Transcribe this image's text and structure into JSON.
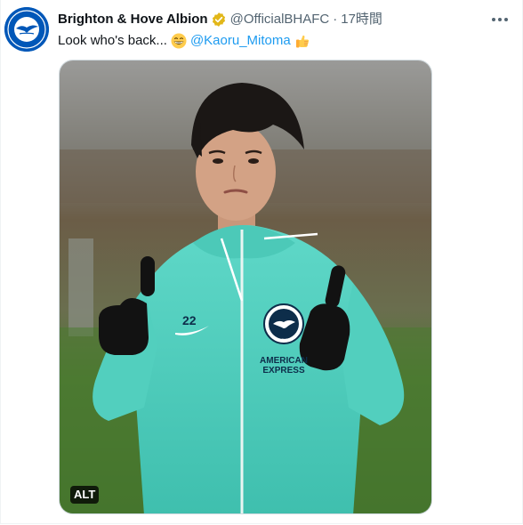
{
  "tweet": {
    "author_name": "Brighton & Hove Albion",
    "handle": "@OfficialBHAFC",
    "separator": "·",
    "time": "17時間",
    "text": "Look who's back...",
    "mention": "@Kaoru_Mitoma",
    "emojis": [
      "grinning-face",
      "thumbs-up"
    ]
  },
  "media": {
    "alt_badge": "ALT",
    "shirt_number": "22",
    "sponsor_line1": "AMERICAN",
    "sponsor_line2": "EXPRESS",
    "crest_text": "ALBION"
  },
  "avatar": {
    "logo_text": "BRIGHTON & HOVE ALBION"
  },
  "colors": {
    "brand_blue": "#0057b8",
    "link_blue": "#1d9bf0",
    "verified_gold": "#e2b719",
    "secondary_text": "#536471",
    "jersey_teal": "#4fd1c1"
  }
}
